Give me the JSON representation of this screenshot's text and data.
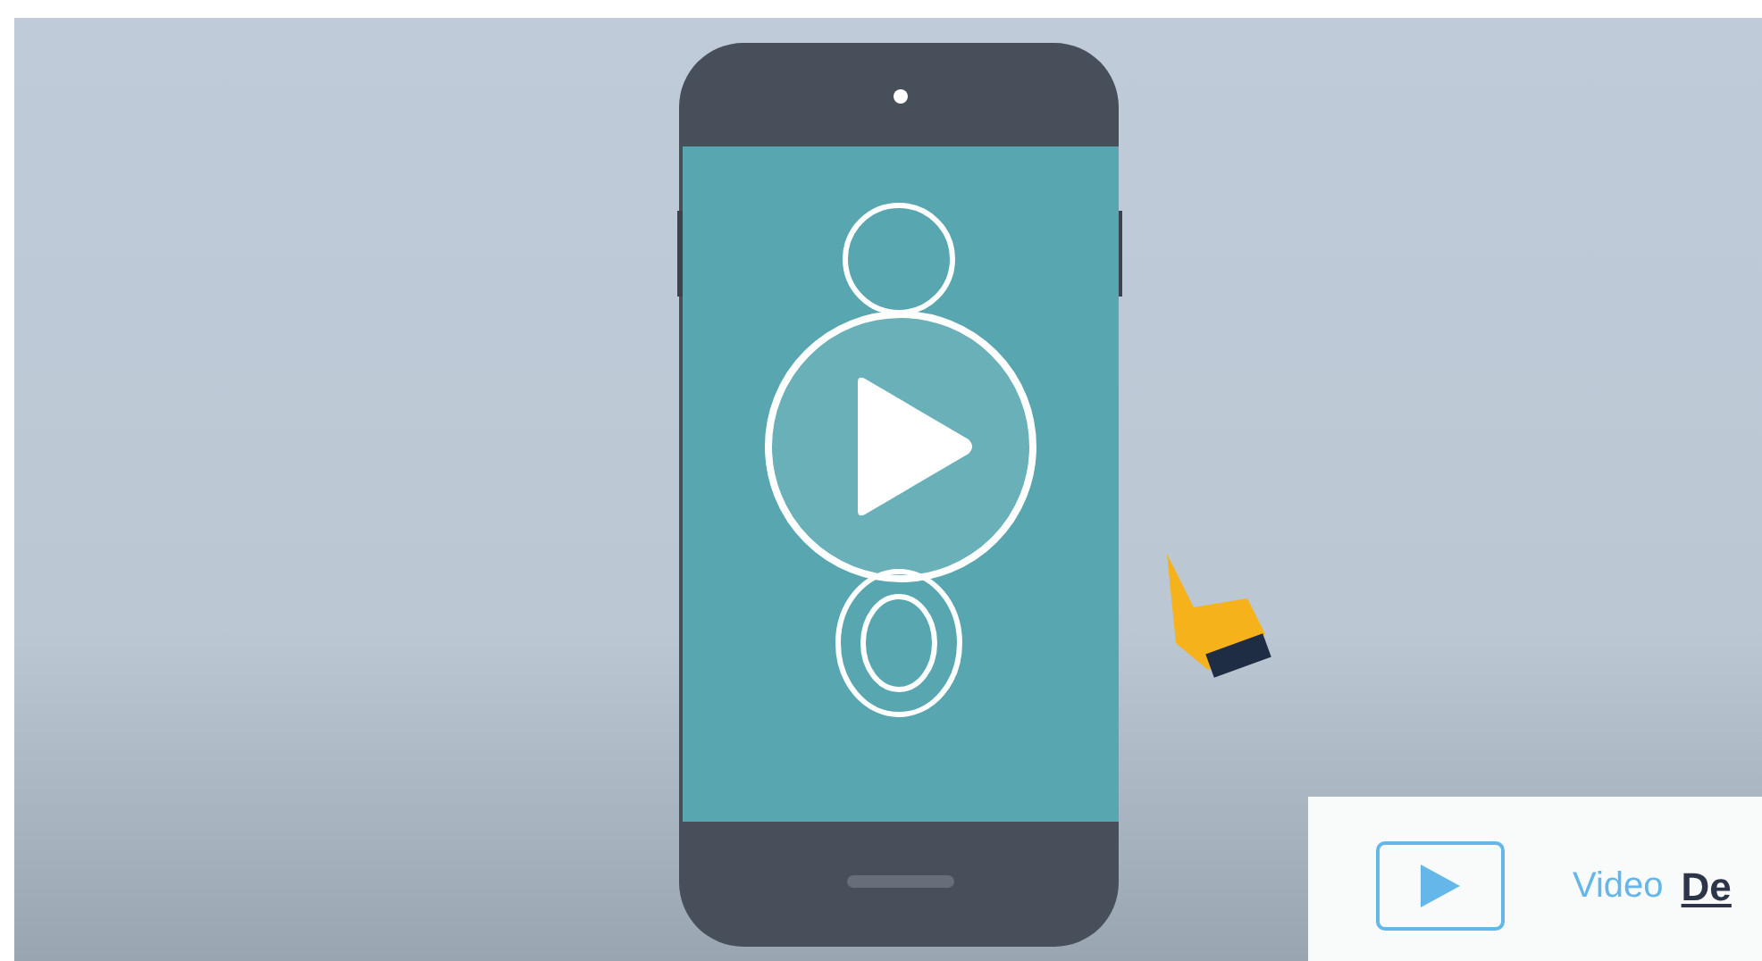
{
  "card": {
    "label": "Video",
    "title": "De"
  }
}
